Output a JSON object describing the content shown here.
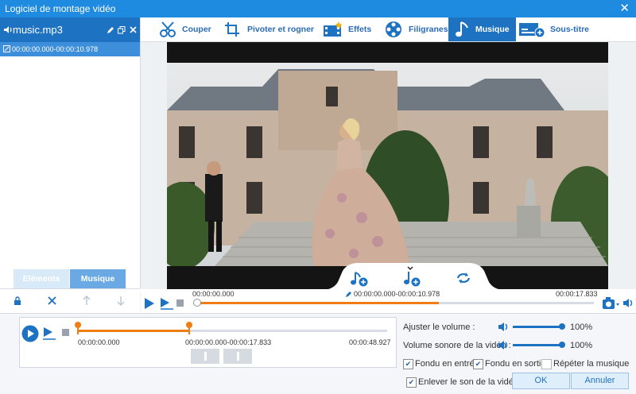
{
  "window": {
    "title": "Logiciel de montage vidéo",
    "close_glyph": "✕"
  },
  "left_panel": {
    "file_name": "music.mp3",
    "clip_range": "00:00:00.000-00:00:10.978",
    "tabs": [
      {
        "label": "Eléments"
      },
      {
        "label": "Musique"
      }
    ]
  },
  "tabs": [
    {
      "label": "Couper",
      "icon": "scissors-icon"
    },
    {
      "label": "Pivoter et rogner",
      "icon": "crop-rotate-icon"
    },
    {
      "label": "Effets",
      "icon": "effects-icon"
    },
    {
      "label": "Filigranes",
      "icon": "film-reel-icon"
    },
    {
      "label": "Musique",
      "icon": "music-note-icon"
    },
    {
      "label": "Sous-titre",
      "icon": "subtitle-icon"
    }
  ],
  "playbar": {
    "time_start": "00:00:00.000",
    "time_range": "00:00:00.000-00:00:10.978",
    "time_end": "00:00:17.833",
    "progress": 0.61
  },
  "audio_track": {
    "start": "00:00:00.000",
    "range": "00:00:00.000-00:00:17.833",
    "end": "00:00:48.927"
  },
  "volume": {
    "adjust_label": "Ajuster le volume :",
    "adjust_value": "100%",
    "video_label": "Volume sonore de la vidéo :",
    "video_value": "100%"
  },
  "options": {
    "fade_in": "Fondu en entrée",
    "fade_out": "Fondu en sortie",
    "repeat": "Répéter la musique",
    "remove_sound": "Enlever le son de la vidéo"
  },
  "buttons": {
    "ok": "OK",
    "cancel": "Annuler"
  },
  "colors": {
    "accent": "#1e72c2",
    "orange": "#f07c14"
  }
}
